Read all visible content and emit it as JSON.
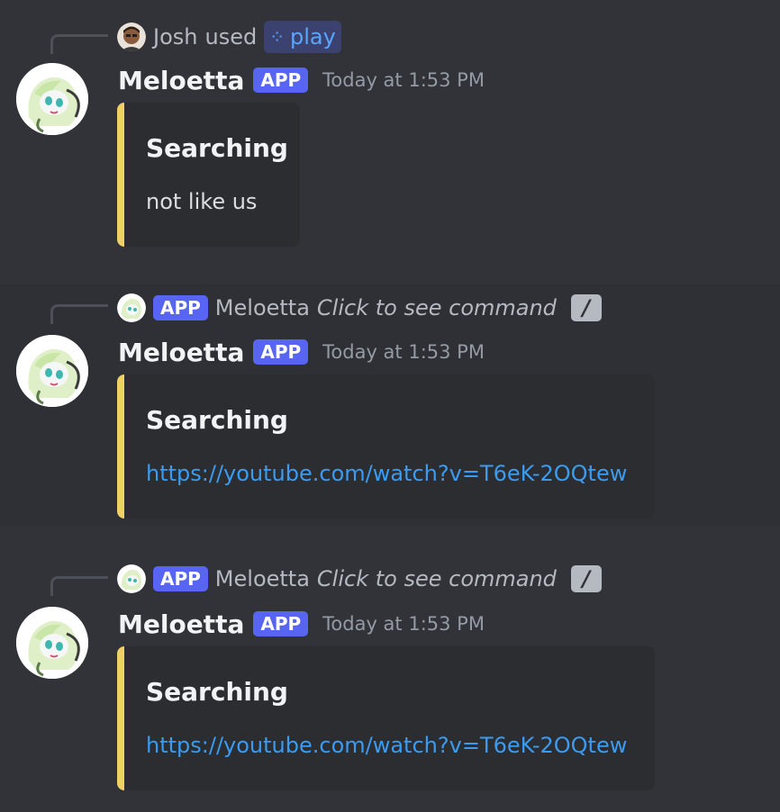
{
  "colors": {
    "background": "#313338",
    "app_tag": "#5865f2",
    "embed_accent": "#f0d065",
    "link": "#3b9bf0"
  },
  "messages": [
    {
      "reply": {
        "user": "Josh",
        "used_text": "used",
        "command": "play",
        "command_icon": "slash-command-icon"
      },
      "author": "Meloetta",
      "tag": "APP",
      "timestamp": "Today at 1:53 PM",
      "embed": {
        "title": "Searching",
        "description": "not like us"
      }
    },
    {
      "reply": {
        "tag": "APP",
        "user": "Meloetta",
        "hint": "Click to see command",
        "command_icon": "slash-icon"
      },
      "author": "Meloetta",
      "tag": "APP",
      "timestamp": "Today at 1:53 PM",
      "embed": {
        "title": "Searching",
        "link": "https://youtube.com/watch?v=T6eK-2OQtew"
      }
    },
    {
      "reply": {
        "tag": "APP",
        "user": "Meloetta",
        "hint": "Click to see command",
        "command_icon": "slash-icon"
      },
      "author": "Meloetta",
      "tag": "APP",
      "timestamp": "Today at 1:53 PM",
      "embed": {
        "title": "Searching",
        "link": "https://youtube.com/watch?v=T6eK-2OQtew"
      }
    }
  ]
}
